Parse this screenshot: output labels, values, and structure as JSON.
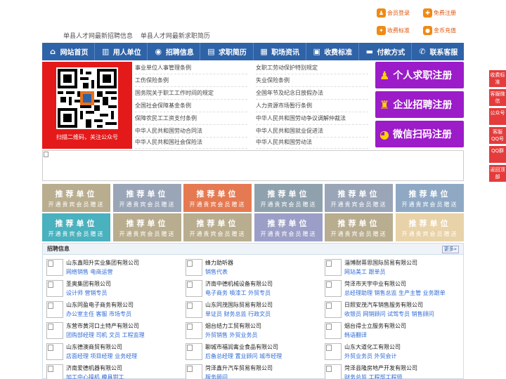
{
  "top": {
    "links": [
      "单县人才网最新招聘信息",
      "单县人才网最新求职简历"
    ],
    "buttons": {
      "member_login": "会员登录",
      "free_register": "免费注册",
      "pricing": "收费标准",
      "coin_recharge": "金币充值"
    }
  },
  "nav": [
    {
      "label": "网站首页",
      "icon": "home-icon"
    },
    {
      "label": "用人单位",
      "icon": "building-icon"
    },
    {
      "label": "招聘信息",
      "icon": "broadcast-icon"
    },
    {
      "label": "求职简历",
      "icon": "resume-icon"
    },
    {
      "label": "职场资讯",
      "icon": "news-icon"
    },
    {
      "label": "收费标准",
      "icon": "coins-icon"
    },
    {
      "label": "付款方式",
      "icon": "card-icon"
    },
    {
      "label": "联系客服",
      "icon": "phone-icon"
    }
  ],
  "qr": {
    "caption": "扫描二维码，关注公众号"
  },
  "laws": {
    "left": [
      "事业单位人事管理条例",
      "工伤保险条例",
      "国务院关于职工工作时间的规定",
      "全国社会保障基金条例",
      "保障农民工工资支付条例",
      "中华人民共和国劳动合同法",
      "中华人民共和国社会保险法"
    ],
    "right": [
      "女职工劳动保护特别规定",
      "失业保险条例",
      "全国年节及纪念日放假办法",
      "人力资源市场暂行条例",
      "中华人民共和国劳动争议调解仲裁法",
      "中华人民共和国就业促进法",
      "中华人民共和国劳动法"
    ]
  },
  "register": {
    "person": "个人求职注册",
    "company": "企业招聘注册",
    "wechat": "微信扫码注册"
  },
  "tiles": {
    "title": "推荐单位",
    "sub": "开通贵宾会员赠送",
    "colors_row1": [
      "#b9ad8f",
      "#9aa5b8",
      "#e57a52",
      "#8fa1ad",
      "#9aa5b8",
      "#8fa9c4"
    ],
    "colors_row2": [
      "#4ab1be",
      "#b9ad8f",
      "#b9ad8f",
      "#9b9fc7",
      "#b9ad8f",
      "#e8d2a8"
    ]
  },
  "float": [
    "收费标准",
    "客服微信",
    "公众号",
    "客服QQ号",
    "QQ群",
    "返回顶部"
  ],
  "jobs": {
    "title": "招聘信息",
    "more": "更多»",
    "companies": [
      {
        "name": "山东鑫阳升实业集团有限公司",
        "pos": "网络销售  电商运营"
      },
      {
        "name": "蜂力助听器",
        "pos": "销售代表"
      },
      {
        "name": "淄博耐蒂思国际贸易有限公司",
        "pos": "网站美工  跟单员"
      },
      {
        "name": "圣奥集团有限公司",
        "pos": "设计师  营销专员"
      },
      {
        "name": "济南中德机械设备有限公司",
        "pos": "电子商务  噴漆工  外贸专员"
      },
      {
        "name": "菏泽市天宇中业有限公司",
        "pos": "总经理助理  销售总监  生产主管  业务跟单"
      },
      {
        "name": "山东同盈电子商务有限公司",
        "pos": "办公室主任  客服  市场专员"
      },
      {
        "name": "山东同茂国际贸易有限公司",
        "pos": "单证员  财务总监  行政文员"
      },
      {
        "name": "日照安茂汽车销售服务有限公司",
        "pos": "收银员  网销顾问  试驾专员  销售顾问"
      },
      {
        "name": "东营市黄河口土特产有限公司",
        "pos": "团购部经理  司机  文员  工程监理"
      },
      {
        "name": "烟台结力工贸有限公司",
        "pos": "外贸销售  外贸业务员"
      },
      {
        "name": "烟台得士立服务有限公司",
        "pos": "韩语翻译"
      },
      {
        "name": "山东德澳商贸有限公司",
        "pos": "店面经理  项目经理  业务经理"
      },
      {
        "name": "聊城市福润禽业食品有限公司",
        "pos": "后备总经理  置业顾问  城市经理"
      },
      {
        "name": "山东大道化工有限公司",
        "pos": "外贸业务员  外贸会计"
      },
      {
        "name": "济南爱德机器有限公司",
        "pos": "加工中心操机  模具钳工"
      },
      {
        "name": "菏泽鑫升汽车贸易有限公司",
        "pos": "服务顾问"
      },
      {
        "name": "菏泽县隆房地产开发有限公司",
        "pos": "财务总监  工程部工程师"
      }
    ]
  }
}
